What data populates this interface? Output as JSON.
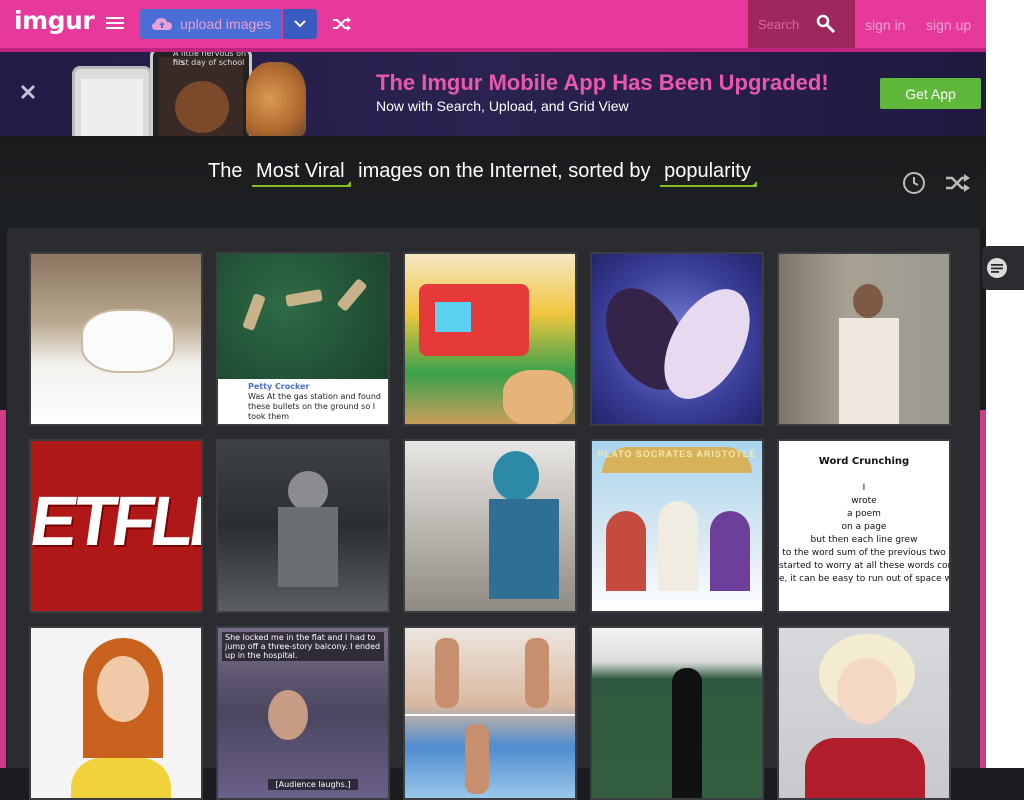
{
  "header": {
    "logo": "imgur",
    "upload_label": "upload images",
    "search_placeholder": "Search",
    "signin": "sign in",
    "signup": "sign up"
  },
  "banner": {
    "title": "The Imgur Mobile App Has Been Upgraded!",
    "subtitle": "Now with Search, Upload, and Grid View",
    "cta": "Get App",
    "phone_text_1": "A little nervous on his",
    "phone_text_2": "first day of school"
  },
  "sort": {
    "prefix": "The",
    "section": "Most Viral",
    "middle": "images on the Internet, sorted by",
    "order": "popularity"
  },
  "gallery": {
    "thumbs": [
      {
        "subject": "bathtub foam"
      },
      {
        "subject": "bullets",
        "caption_name": "Petty Crocker",
        "caption_text": "Was At the gas station and found these bullets on the ground so I took them"
      },
      {
        "subject": "playhouse"
      },
      {
        "subject": "koi fish"
      },
      {
        "subject": "man walking"
      },
      {
        "subject": "netflix",
        "text": "ETFLIX"
      },
      {
        "subject": "knight"
      },
      {
        "subject": "mascot"
      },
      {
        "subject": "philosophers",
        "text": "PLATO SOCRATES ARISTOTLE"
      },
      {
        "subject": "poem",
        "title": "Word Crunching",
        "lines": [
          "I",
          "wrote",
          "a poem",
          "on a page",
          "but then each line grew",
          "to the word sum of the previous two",
          "started to worry at all these words coming with such frequen",
          "e, it can be easy to run out of space when a poem gets all f"
        ]
      },
      {
        "subject": "redhead"
      },
      {
        "subject": "tv show",
        "meme_top": "She locked me in the flat and I had to jump off a three-story balcony. I ended up in the hospital.",
        "meme_bottom": "[Audience laughs.]"
      },
      {
        "subject": "beach"
      },
      {
        "subject": "baseball"
      },
      {
        "subject": "cosplay"
      }
    ]
  },
  "colors": {
    "brand_pink": "#e6399b",
    "upload_blue": "#4a6dd6",
    "accent_green": "#85bf25",
    "getapp_green": "#5fb83a"
  }
}
